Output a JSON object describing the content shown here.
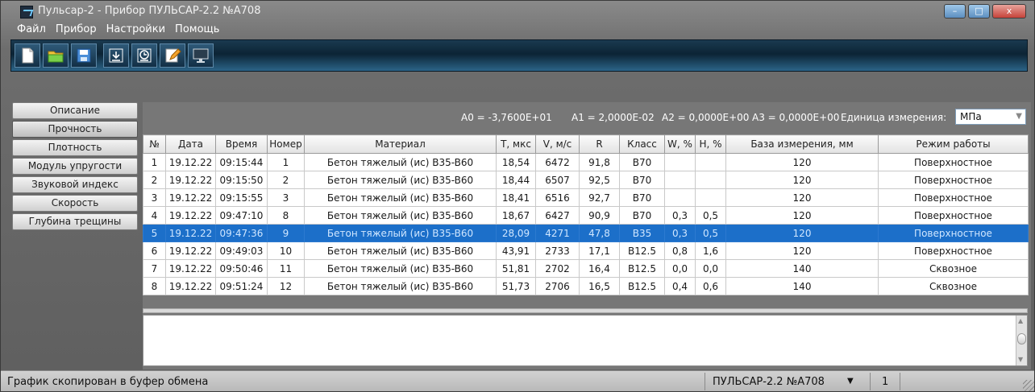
{
  "window": {
    "title": "Пульсар-2 - Прибор ПУЛЬСАР-2.2 №А708",
    "controls": {
      "minimize": "–",
      "maximize": "□",
      "close": "x"
    }
  },
  "menu": [
    "Файл",
    "Прибор",
    "Настройки",
    "Помощь"
  ],
  "toolbar": {
    "icons": [
      "new-file-icon",
      "open-folder-icon",
      "save-icon",
      "download-icon",
      "history-icon",
      "edit-icon",
      "monitor-icon"
    ]
  },
  "sidebar": {
    "items": [
      {
        "label": "Описание"
      },
      {
        "label": "Прочность",
        "active": true
      },
      {
        "label": "Плотность"
      },
      {
        "label": "Модуль упругости"
      },
      {
        "label": "Звуковой индекс"
      },
      {
        "label": "Скорость"
      },
      {
        "label": "Глубина трещины"
      }
    ]
  },
  "params": {
    "a0": "A0 = -3,7600E+01",
    "a1": "A1 = 2,0000E-02",
    "a2": "A2 = 0,0000E+00",
    "a3": "A3 = 0,0000E+00",
    "unit_label": "Единица измерения:",
    "unit_value": "МПа"
  },
  "table": {
    "columns": [
      "№",
      "Дата",
      "Время",
      "Номер",
      "Материал",
      "T, мкс",
      "V, м/с",
      "R",
      "Класс",
      "W, %",
      "H, %",
      "База измерения, мм",
      "Режим работы"
    ],
    "rows": [
      [
        "1",
        "19.12.22",
        "09:15:44",
        "1",
        "Бетон тяжелый (ис) B35-B60",
        "18,54",
        "6472",
        "91,8",
        "B70",
        "",
        "",
        "120",
        "Поверхностное"
      ],
      [
        "2",
        "19.12.22",
        "09:15:50",
        "2",
        "Бетон тяжелый (ис) B35-B60",
        "18,44",
        "6507",
        "92,5",
        "B70",
        "",
        "",
        "120",
        "Поверхностное"
      ],
      [
        "3",
        "19.12.22",
        "09:15:55",
        "3",
        "Бетон тяжелый (ис) B35-B60",
        "18,41",
        "6516",
        "92,7",
        "B70",
        "",
        "",
        "120",
        "Поверхностное"
      ],
      [
        "4",
        "19.12.22",
        "09:47:10",
        "8",
        "Бетон тяжелый (ис) B35-B60",
        "18,67",
        "6427",
        "90,9",
        "B70",
        "0,3",
        "0,5",
        "120",
        "Поверхностное"
      ],
      [
        "5",
        "19.12.22",
        "09:47:36",
        "9",
        "Бетон тяжелый (ис) B35-B60",
        "28,09",
        "4271",
        "47,8",
        "B35",
        "0,3",
        "0,5",
        "120",
        "Поверхностное"
      ],
      [
        "6",
        "19.12.22",
        "09:49:03",
        "10",
        "Бетон тяжелый (ис) B35-B60",
        "43,91",
        "2733",
        "17,1",
        "B12.5",
        "0,8",
        "1,6",
        "120",
        "Поверхностное"
      ],
      [
        "7",
        "19.12.22",
        "09:50:46",
        "11",
        "Бетон тяжелый (ис) B35-B60",
        "51,81",
        "2702",
        "16,4",
        "B12.5",
        "0,0",
        "0,0",
        "140",
        "Сквозное"
      ],
      [
        "8",
        "19.12.22",
        "09:51:24",
        "12",
        "Бетон тяжелый (ис) B35-B60",
        "51,73",
        "2706",
        "16,5",
        "B12.5",
        "0,4",
        "0,6",
        "140",
        "Сквозное"
      ]
    ],
    "selected_row": 5
  },
  "status": {
    "message": "График скопирован в буфер обмена",
    "device": "ПУЛЬСАР-2.2 №А708",
    "port": "1"
  },
  "colors": {
    "selection": "#1c6fc9",
    "toolbar": "#0c2435"
  }
}
